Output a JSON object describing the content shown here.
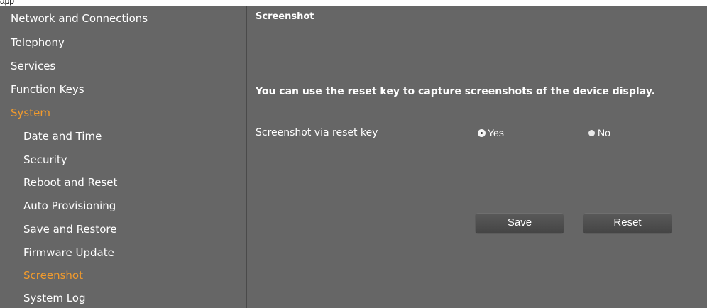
{
  "window": {
    "title": "app"
  },
  "sidebar": {
    "items": [
      {
        "label": "Network and Connections",
        "active": false
      },
      {
        "label": "Telephony",
        "active": false
      },
      {
        "label": "Services",
        "active": false
      },
      {
        "label": "Function Keys",
        "active": false
      },
      {
        "label": "System",
        "active": true
      }
    ],
    "subitems": [
      {
        "label": "Date and Time",
        "active": false
      },
      {
        "label": "Security",
        "active": false
      },
      {
        "label": "Reboot and Reset",
        "active": false
      },
      {
        "label": "Auto Provisioning",
        "active": false
      },
      {
        "label": "Save and Restore",
        "active": false
      },
      {
        "label": "Firmware Update",
        "active": false
      },
      {
        "label": "Screenshot",
        "active": true
      },
      {
        "label": "System Log",
        "active": false
      }
    ]
  },
  "main": {
    "title": "Screenshot",
    "description": "You can use the reset key to capture screenshots of the device display.",
    "setting": {
      "label": "Screenshot via reset key",
      "options": [
        {
          "label": "Yes",
          "selected": true
        },
        {
          "label": "No",
          "selected": false
        }
      ]
    },
    "buttons": {
      "save": "Save",
      "reset": "Reset"
    }
  },
  "colors": {
    "background": "#666666",
    "text": "#ffffff",
    "active": "#f29b2d"
  }
}
